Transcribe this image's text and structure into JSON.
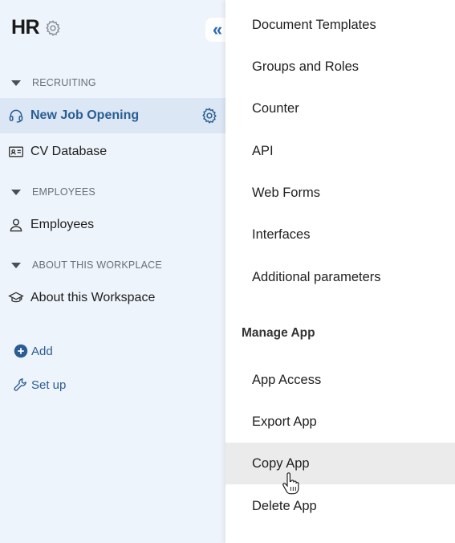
{
  "workspace": {
    "title": "HR",
    "settings_icon": "gear-icon"
  },
  "collapse": {
    "label": "«"
  },
  "sidebar": {
    "sections": [
      {
        "label": "RECRUITING"
      },
      {
        "label": "EMPLOYEES"
      },
      {
        "label": "ABOUT THIS WORKPLACE"
      }
    ],
    "items": [
      {
        "label": "New Job Opening",
        "icon": "headset-icon",
        "active": true
      },
      {
        "label": "CV Database",
        "icon": "id-card-icon"
      },
      {
        "label": "Employees",
        "icon": "person-icon"
      },
      {
        "label": "About this Workspace",
        "icon": "graduation-cap-icon"
      }
    ],
    "actions": [
      {
        "label": "Add",
        "icon": "plus-circle-icon"
      },
      {
        "label": "Set up",
        "icon": "wrench-icon"
      }
    ]
  },
  "menu": {
    "items": [
      {
        "label": "Document Templates"
      },
      {
        "label": "Groups and Roles"
      },
      {
        "label": "Counter"
      },
      {
        "label": "API"
      },
      {
        "label": "Web Forms"
      },
      {
        "label": "Interfaces"
      },
      {
        "label": "Additional parameters"
      }
    ],
    "section_title": "Manage App",
    "manage_items": [
      {
        "label": "App Access"
      },
      {
        "label": "Export App"
      },
      {
        "label": "Copy App",
        "hovered": true
      },
      {
        "label": "Delete App"
      }
    ]
  },
  "colors": {
    "accent": "#2a5d94",
    "sidebar_bg": "#eef4fb",
    "active_bg": "#dbe7f4",
    "hover_bg": "#ebebeb"
  }
}
